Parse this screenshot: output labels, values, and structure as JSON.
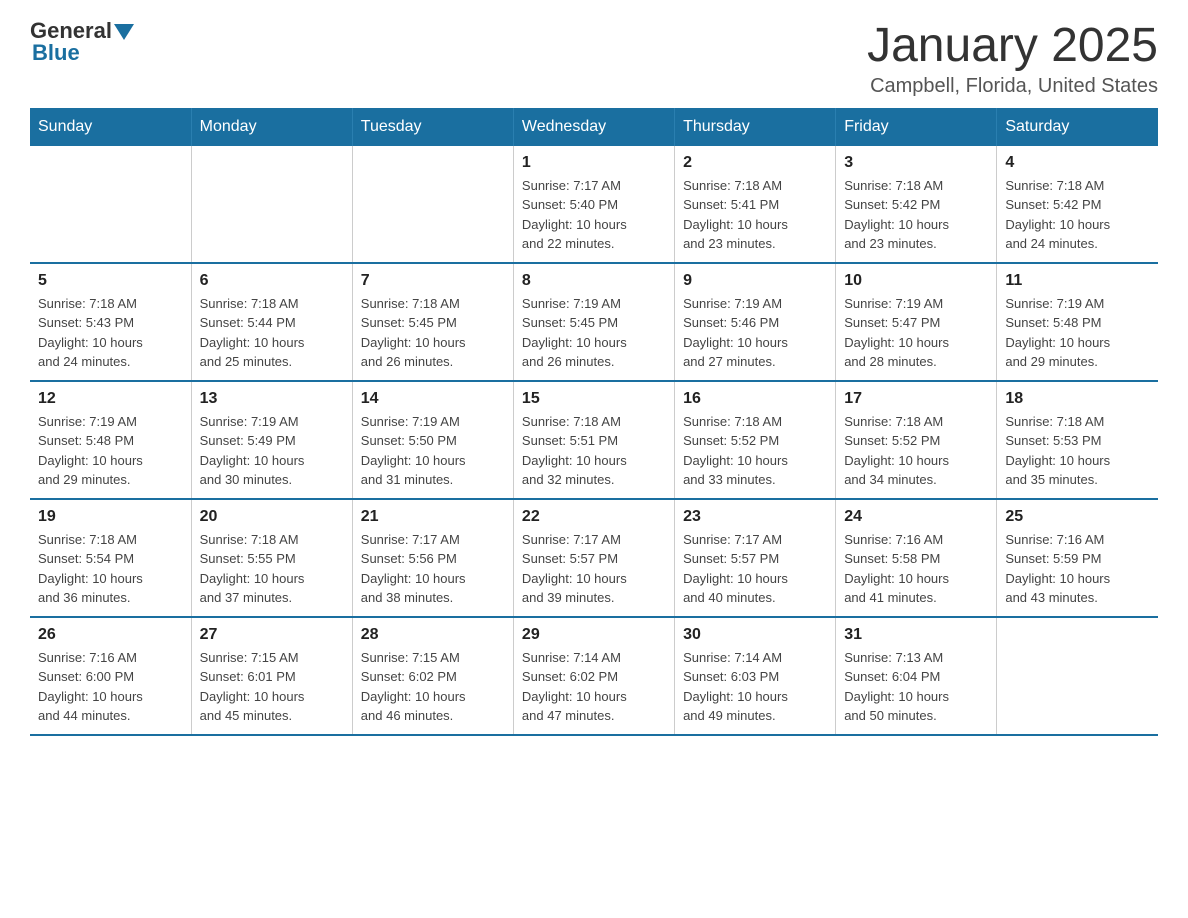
{
  "logo": {
    "general": "General",
    "blue": "Blue"
  },
  "title": "January 2025",
  "location": "Campbell, Florida, United States",
  "days_of_week": [
    "Sunday",
    "Monday",
    "Tuesday",
    "Wednesday",
    "Thursday",
    "Friday",
    "Saturday"
  ],
  "weeks": [
    [
      {
        "day": "",
        "info": ""
      },
      {
        "day": "",
        "info": ""
      },
      {
        "day": "",
        "info": ""
      },
      {
        "day": "1",
        "info": "Sunrise: 7:17 AM\nSunset: 5:40 PM\nDaylight: 10 hours\nand 22 minutes."
      },
      {
        "day": "2",
        "info": "Sunrise: 7:18 AM\nSunset: 5:41 PM\nDaylight: 10 hours\nand 23 minutes."
      },
      {
        "day": "3",
        "info": "Sunrise: 7:18 AM\nSunset: 5:42 PM\nDaylight: 10 hours\nand 23 minutes."
      },
      {
        "day": "4",
        "info": "Sunrise: 7:18 AM\nSunset: 5:42 PM\nDaylight: 10 hours\nand 24 minutes."
      }
    ],
    [
      {
        "day": "5",
        "info": "Sunrise: 7:18 AM\nSunset: 5:43 PM\nDaylight: 10 hours\nand 24 minutes."
      },
      {
        "day": "6",
        "info": "Sunrise: 7:18 AM\nSunset: 5:44 PM\nDaylight: 10 hours\nand 25 minutes."
      },
      {
        "day": "7",
        "info": "Sunrise: 7:18 AM\nSunset: 5:45 PM\nDaylight: 10 hours\nand 26 minutes."
      },
      {
        "day": "8",
        "info": "Sunrise: 7:19 AM\nSunset: 5:45 PM\nDaylight: 10 hours\nand 26 minutes."
      },
      {
        "day": "9",
        "info": "Sunrise: 7:19 AM\nSunset: 5:46 PM\nDaylight: 10 hours\nand 27 minutes."
      },
      {
        "day": "10",
        "info": "Sunrise: 7:19 AM\nSunset: 5:47 PM\nDaylight: 10 hours\nand 28 minutes."
      },
      {
        "day": "11",
        "info": "Sunrise: 7:19 AM\nSunset: 5:48 PM\nDaylight: 10 hours\nand 29 minutes."
      }
    ],
    [
      {
        "day": "12",
        "info": "Sunrise: 7:19 AM\nSunset: 5:48 PM\nDaylight: 10 hours\nand 29 minutes."
      },
      {
        "day": "13",
        "info": "Sunrise: 7:19 AM\nSunset: 5:49 PM\nDaylight: 10 hours\nand 30 minutes."
      },
      {
        "day": "14",
        "info": "Sunrise: 7:19 AM\nSunset: 5:50 PM\nDaylight: 10 hours\nand 31 minutes."
      },
      {
        "day": "15",
        "info": "Sunrise: 7:18 AM\nSunset: 5:51 PM\nDaylight: 10 hours\nand 32 minutes."
      },
      {
        "day": "16",
        "info": "Sunrise: 7:18 AM\nSunset: 5:52 PM\nDaylight: 10 hours\nand 33 minutes."
      },
      {
        "day": "17",
        "info": "Sunrise: 7:18 AM\nSunset: 5:52 PM\nDaylight: 10 hours\nand 34 minutes."
      },
      {
        "day": "18",
        "info": "Sunrise: 7:18 AM\nSunset: 5:53 PM\nDaylight: 10 hours\nand 35 minutes."
      }
    ],
    [
      {
        "day": "19",
        "info": "Sunrise: 7:18 AM\nSunset: 5:54 PM\nDaylight: 10 hours\nand 36 minutes."
      },
      {
        "day": "20",
        "info": "Sunrise: 7:18 AM\nSunset: 5:55 PM\nDaylight: 10 hours\nand 37 minutes."
      },
      {
        "day": "21",
        "info": "Sunrise: 7:17 AM\nSunset: 5:56 PM\nDaylight: 10 hours\nand 38 minutes."
      },
      {
        "day": "22",
        "info": "Sunrise: 7:17 AM\nSunset: 5:57 PM\nDaylight: 10 hours\nand 39 minutes."
      },
      {
        "day": "23",
        "info": "Sunrise: 7:17 AM\nSunset: 5:57 PM\nDaylight: 10 hours\nand 40 minutes."
      },
      {
        "day": "24",
        "info": "Sunrise: 7:16 AM\nSunset: 5:58 PM\nDaylight: 10 hours\nand 41 minutes."
      },
      {
        "day": "25",
        "info": "Sunrise: 7:16 AM\nSunset: 5:59 PM\nDaylight: 10 hours\nand 43 minutes."
      }
    ],
    [
      {
        "day": "26",
        "info": "Sunrise: 7:16 AM\nSunset: 6:00 PM\nDaylight: 10 hours\nand 44 minutes."
      },
      {
        "day": "27",
        "info": "Sunrise: 7:15 AM\nSunset: 6:01 PM\nDaylight: 10 hours\nand 45 minutes."
      },
      {
        "day": "28",
        "info": "Sunrise: 7:15 AM\nSunset: 6:02 PM\nDaylight: 10 hours\nand 46 minutes."
      },
      {
        "day": "29",
        "info": "Sunrise: 7:14 AM\nSunset: 6:02 PM\nDaylight: 10 hours\nand 47 minutes."
      },
      {
        "day": "30",
        "info": "Sunrise: 7:14 AM\nSunset: 6:03 PM\nDaylight: 10 hours\nand 49 minutes."
      },
      {
        "day": "31",
        "info": "Sunrise: 7:13 AM\nSunset: 6:04 PM\nDaylight: 10 hours\nand 50 minutes."
      },
      {
        "day": "",
        "info": ""
      }
    ]
  ]
}
